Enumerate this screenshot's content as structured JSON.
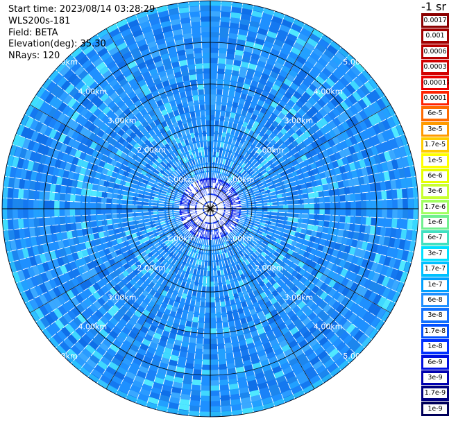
{
  "header": {
    "start_time": "Start time: 2023/08/14 03:28:29",
    "instrument": "WLS200s-181",
    "field": "Field: BETA",
    "elevation": "Elevation(deg): 35.30",
    "nrays": "NRays: 120"
  },
  "plot": {
    "type": "ppi",
    "nrays": 120,
    "max_range_km": 5.0,
    "range_rings_km": [
      0.5,
      1.0,
      2.0,
      3.0,
      4.0,
      5.0
    ],
    "ring_label_values_km": [
      1.0,
      2.0,
      3.0,
      4.0,
      5.0
    ],
    "ring_labels": [
      "1.00km",
      "2.00km",
      "3.00km",
      "4.00km",
      "5.00km"
    ],
    "ring_label_quadrant": [
      "upper-left",
      "upper-right",
      "lower-left",
      "lower-right"
    ],
    "dominant_value_color": "#1e90ff",
    "grid_color": "#000000"
  },
  "colorbar": {
    "units": "-1 sr",
    "cells": [
      {
        "label": "0.0017",
        "color": "#8b0000"
      },
      {
        "label": "0.001",
        "color": "#a00000"
      },
      {
        "label": "0.0006",
        "color": "#b80000"
      },
      {
        "label": "0.0003",
        "color": "#d20000"
      },
      {
        "label": "0.00017",
        "color": "#e80000"
      },
      {
        "label": "0.0001",
        "color": "#ff2200"
      },
      {
        "label": "6e-5",
        "color": "#ff6a00"
      },
      {
        "label": "3e-5",
        "color": "#ff9a00"
      },
      {
        "label": "1.7e-5",
        "color": "#ffcc00"
      },
      {
        "label": "1e-5",
        "color": "#ffff00"
      },
      {
        "label": "6e-6",
        "color": "#e6ff00"
      },
      {
        "label": "3e-6",
        "color": "#c8ff30"
      },
      {
        "label": "1.7e-6",
        "color": "#a0ff60"
      },
      {
        "label": "1e-6",
        "color": "#70f090"
      },
      {
        "label": "6e-7",
        "color": "#40e0c0"
      },
      {
        "label": "3e-7",
        "color": "#00e0ff"
      },
      {
        "label": "1.7e-7",
        "color": "#00c0ff"
      },
      {
        "label": "1e-7",
        "color": "#00a0ff"
      },
      {
        "label": "6e-8",
        "color": "#1e90ff"
      },
      {
        "label": "3e-8",
        "color": "#1070ff"
      },
      {
        "label": "1.7e-8",
        "color": "#0050ff"
      },
      {
        "label": "1e-8",
        "color": "#0030ff"
      },
      {
        "label": "6e-9",
        "color": "#0010e0"
      },
      {
        "label": "3e-9",
        "color": "#0000b0"
      },
      {
        "label": "1.7e-9",
        "color": "#000080"
      },
      {
        "label": "1e-9",
        "color": "#00005a"
      }
    ]
  }
}
